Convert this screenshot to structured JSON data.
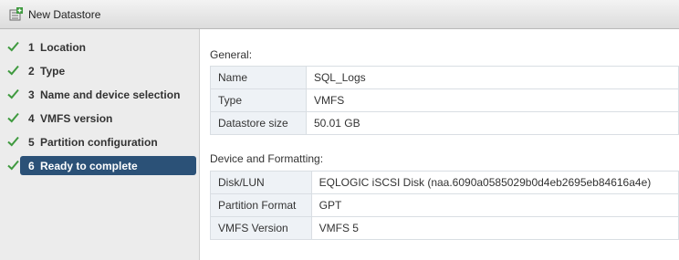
{
  "window": {
    "title": "New Datastore",
    "icon": "datastore-add-icon"
  },
  "steps": [
    {
      "num": "1",
      "label": "Location",
      "done": true,
      "active": false
    },
    {
      "num": "2",
      "label": "Type",
      "done": true,
      "active": false
    },
    {
      "num": "3",
      "label": "Name and device selection",
      "done": true,
      "active": false
    },
    {
      "num": "4",
      "label": "VMFS version",
      "done": true,
      "active": false
    },
    {
      "num": "5",
      "label": "Partition configuration",
      "done": true,
      "active": false
    },
    {
      "num": "6",
      "label": "Ready to complete",
      "done": true,
      "active": true
    }
  ],
  "general": {
    "title": "General:",
    "rows": [
      {
        "key": "Name",
        "value": "SQL_Logs"
      },
      {
        "key": "Type",
        "value": "VMFS"
      },
      {
        "key": "Datastore size",
        "value": "50.01 GB"
      }
    ]
  },
  "device": {
    "title": "Device and Formatting:",
    "rows": [
      {
        "key": "Disk/LUN",
        "value": "EQLOGIC iSCSI Disk (naa.6090a0585029b0d4eb2695eb84616a4e)"
      },
      {
        "key": "Partition Format",
        "value": "GPT"
      },
      {
        "key": "VMFS Version",
        "value": "VMFS 5"
      }
    ]
  },
  "colors": {
    "accent": "#2b5177",
    "check": "#3f9a3f",
    "key_bg": "#eef2f6"
  }
}
